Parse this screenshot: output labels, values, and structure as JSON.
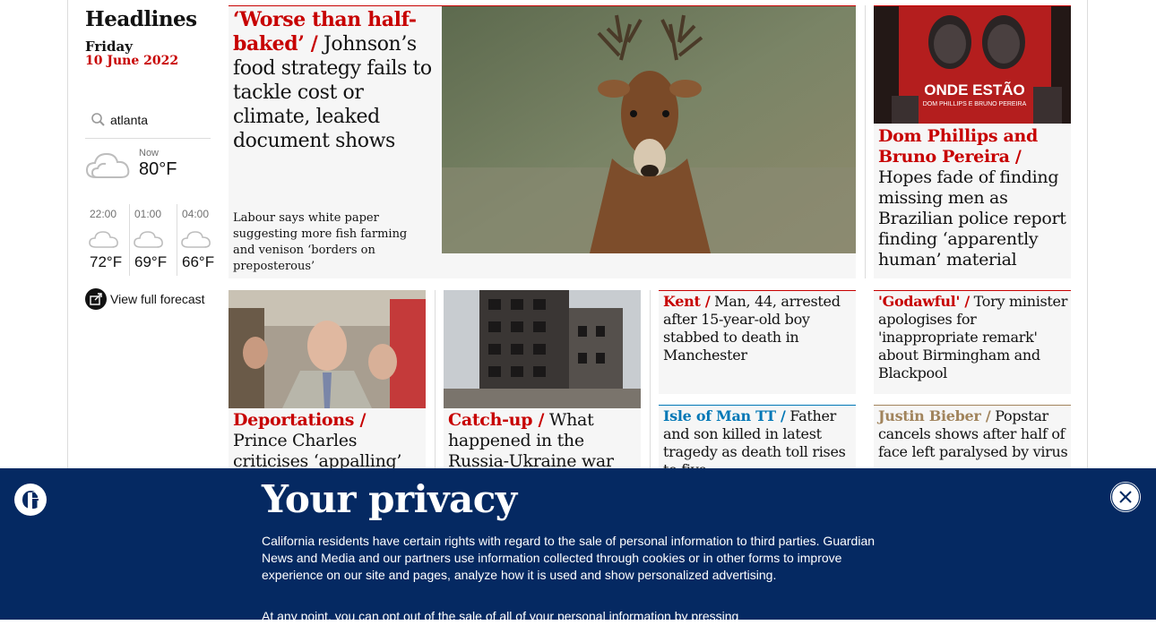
{
  "sidebar": {
    "section_title": "Headlines",
    "day": "Friday",
    "date": "10 June 2022",
    "search": {
      "value": "atlanta",
      "icon": "search-icon"
    },
    "weather": {
      "now_label": "Now",
      "now_temp": "80°F",
      "forecast": [
        {
          "time": "22:00",
          "temp": "72°F"
        },
        {
          "time": "01:00",
          "temp": "69°F"
        },
        {
          "time": "04:00",
          "temp": "66°F"
        }
      ],
      "full_forecast_label": "View full forecast"
    }
  },
  "stories": {
    "lead": {
      "kicker": "‘Worse than half-baked’ /",
      "headline": "Johnson’s food strategy fails to tackle cost or climate, leaked document shows",
      "standfirst": "Labour says white paper suggesting more fish farming and venison ‘borders on preposterous’"
    },
    "right_top": {
      "kicker": "Dom Phillips and Bruno Pereira /",
      "headline": "Hopes fade of finding missing men as Brazilian police report finding ‘apparently human’ material",
      "image_banner_text": "ONDE ESTÃO",
      "image_sub_text": "DOM PHILLIPS E BRUNO PEREIRA"
    },
    "charles": {
      "kicker": "Deportations /",
      "headline": "Prince Charles criticises ‘appalling’ Rwanda"
    },
    "ukraine": {
      "kicker": "Catch-up /",
      "headline": "What happened in the Russia-Ukraine war"
    },
    "kent": {
      "kicker": "Kent /",
      "headline": "Man, 44, arrested after 15-year-old boy stabbed to death in Manchester"
    },
    "godawful": {
      "kicker": "'Godawful' /",
      "headline": "Tory minister apologises for 'inappropriate remark' about Birmingham and Blackpool"
    },
    "iom": {
      "kicker": "Isle of Man TT /",
      "headline": "Father and son killed in latest tragedy as death toll rises to five"
    },
    "bieber": {
      "kicker": "Justin Bieber /",
      "headline": "Popstar cancels shows after half of face left paralysed by virus"
    }
  },
  "privacy": {
    "title": "Your privacy",
    "body": "California residents have certain rights with regard to the sale of personal information to third parties. Guardian News and Media and our partners use information collected through cookies or in other forms to improve experience on our site and pages, analyze how it is used and show personalized advertising.",
    "body2": "At any point, you can opt out of the sale of all of your personal information by pressing"
  },
  "colors": {
    "news_red": "#c70000",
    "sport_blue": "#0077b6",
    "culture_gold": "#a1845c",
    "brand_blue": "#052962"
  }
}
